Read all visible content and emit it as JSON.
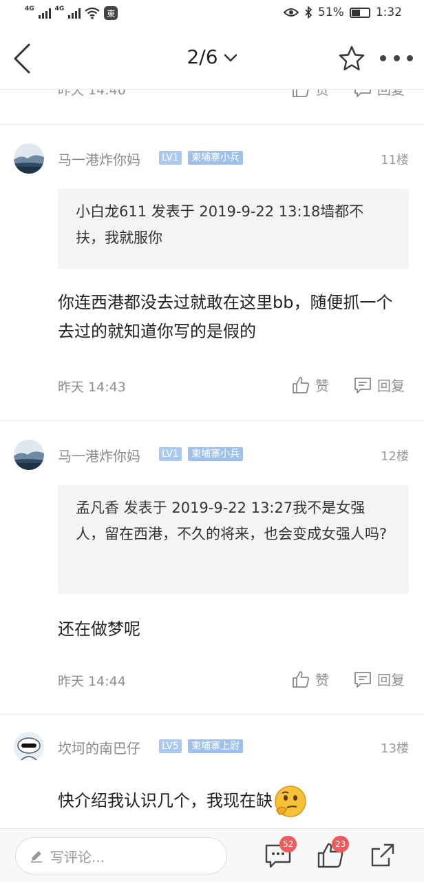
{
  "status_bar": {
    "net1": "4G",
    "net2": "4G",
    "app_glyph": "東",
    "battery": "51%",
    "battery_level": 0.51,
    "time": "1:32"
  },
  "header": {
    "page_indicator": "2/6"
  },
  "previous_post": {
    "time": "昨天 14:40",
    "like_label": "赞",
    "reply_label": "回复"
  },
  "posts": [
    {
      "username": "马一港炸你妈",
      "level": "LV1",
      "rank": "柬埔寨小兵",
      "floor": "11楼",
      "quote": "小白龙611 发表于 2019-9-22 13:18墙都不扶，我就服你",
      "body": "你连西港都没去过就敢在这里bb，随便抓一个去过的就知道你写的是假的",
      "time": "昨天 14:43",
      "like_label": "赞",
      "reply_label": "回复"
    },
    {
      "username": "马一港炸你妈",
      "level": "LV1",
      "rank": "柬埔寨小兵",
      "floor": "12楼",
      "quote": "孟凡香 发表于 2019-9-22 13:27我不是女强人，留在西港，不久的将来，也会变成女强人吗?",
      "body": "还在做梦呢",
      "time": "昨天 14:44",
      "like_label": "赞",
      "reply_label": "回复"
    },
    {
      "username": "坎坷的南巴仔",
      "level": "LV5",
      "rank": "柬埔寨上尉",
      "floor": "13楼",
      "body": "快介绍我认识几个，我现在缺"
    }
  ],
  "bottom_bar": {
    "comment_placeholder": "写评论...",
    "comment_count": "52",
    "like_count": "23"
  },
  "icons": {
    "back": "chevron-left-icon",
    "dropdown": "chevron-down-icon",
    "favorite": "star-icon",
    "more": "more-dots-icon",
    "like": "thumbs-up-icon",
    "reply": "comment-icon",
    "share": "share-icon",
    "edit": "pencil-icon"
  }
}
